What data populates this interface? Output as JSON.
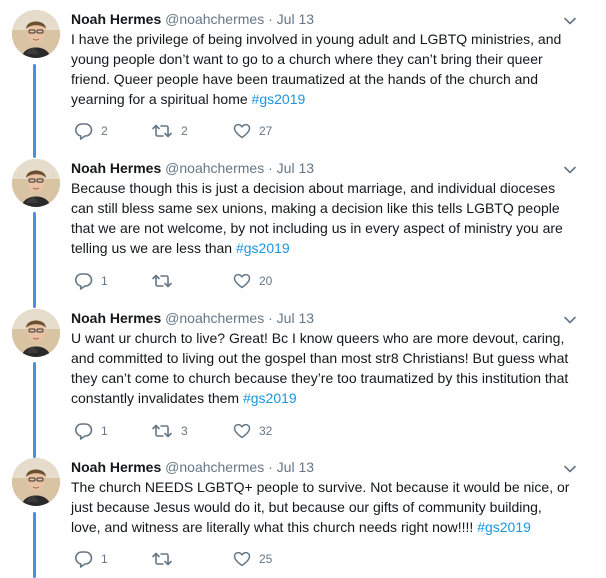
{
  "thread_color": "#4a90e2",
  "tweets": [
    {
      "name": "Noah Hermes",
      "handle": "@noahchermes",
      "separator": "·",
      "date": "Jul 13",
      "text": "I have the privilege of being involved in young adult and LGBTQ ministries, and young people don’t want to go to a church where they can’t bring their queer friend. Queer people have been traumatized at the hands of the church and yearning for a spiritual home ",
      "hashtag": "#gs2019",
      "replies": "2",
      "retweets": "2",
      "likes": "27"
    },
    {
      "name": "Noah Hermes",
      "handle": "@noahchermes",
      "separator": "·",
      "date": "Jul 13",
      "text": "Because though this is just a decision about marriage, and individual dioceses can still bless same sex unions, making a decision like this tells LGBTQ people that we are not welcome, by not including us in every aspect of ministry you are telling us we are less than ",
      "hashtag": "#gs2019",
      "replies": "1",
      "retweets": "",
      "likes": "20"
    },
    {
      "name": "Noah Hermes",
      "handle": "@noahchermes",
      "separator": "·",
      "date": "Jul 13",
      "text": "U want ur church to live? Great! Bc I know queers who are more devout, caring, and committed to living out the gospel than most str8 Christians! But guess what they can’t come to church because they’re too traumatized by this institution that constantly invalidates them ",
      "hashtag": "#gs2019",
      "replies": "1",
      "retweets": "3",
      "likes": "32"
    },
    {
      "name": "Noah Hermes",
      "handle": "@noahchermes",
      "separator": "·",
      "date": "Jul 13",
      "text": "The church NEEDS LGBTQ+ people to survive. Not because it would be nice, or just because Jesus would do it, but because our gifts of community building, love, and witness are literally what this church needs right now!!!! ",
      "hashtag": "#gs2019",
      "replies": "1",
      "retweets": "",
      "likes": "25"
    }
  ]
}
